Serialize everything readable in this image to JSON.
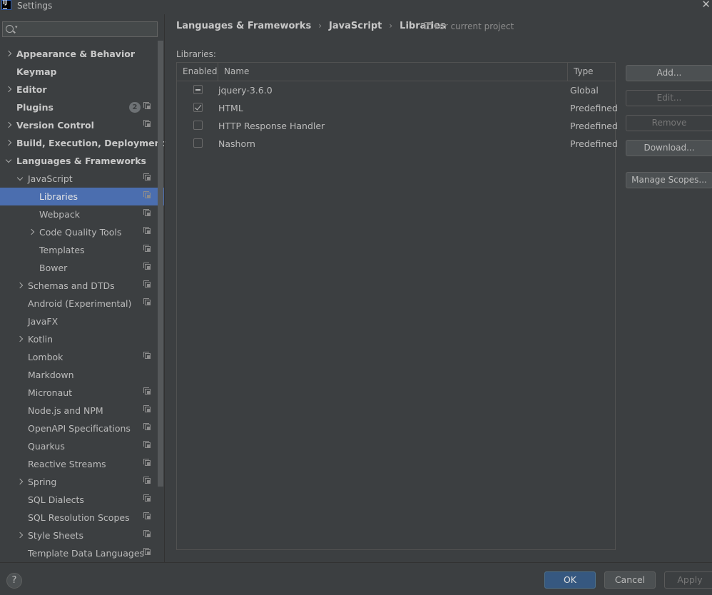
{
  "window": {
    "title": "Settings"
  },
  "search": {
    "placeholder": "",
    "value": ""
  },
  "sidebar": {
    "items": [
      {
        "label": "Appearance & Behavior"
      },
      {
        "label": "Keymap"
      },
      {
        "label": "Editor"
      },
      {
        "label": "Plugins",
        "badge": "2"
      },
      {
        "label": "Version Control"
      },
      {
        "label": "Build, Execution, Deployment"
      },
      {
        "label": "Languages & Frameworks"
      },
      {
        "label": "JavaScript"
      },
      {
        "label": "Libraries"
      },
      {
        "label": "Webpack"
      },
      {
        "label": "Code Quality Tools"
      },
      {
        "label": "Templates"
      },
      {
        "label": "Bower"
      },
      {
        "label": "Schemas and DTDs"
      },
      {
        "label": "Android (Experimental)"
      },
      {
        "label": "JavaFX"
      },
      {
        "label": "Kotlin"
      },
      {
        "label": "Lombok"
      },
      {
        "label": "Markdown"
      },
      {
        "label": "Micronaut"
      },
      {
        "label": "Node.js and NPM"
      },
      {
        "label": "OpenAPI Specifications"
      },
      {
        "label": "Quarkus"
      },
      {
        "label": "Reactive Streams"
      },
      {
        "label": "Spring"
      },
      {
        "label": "SQL Dialects"
      },
      {
        "label": "SQL Resolution Scopes"
      },
      {
        "label": "Style Sheets"
      },
      {
        "label": "Template Data Languages"
      }
    ]
  },
  "breadcrumb": [
    "Languages & Frameworks",
    "JavaScript",
    "Libraries"
  ],
  "scope_note": "For current project",
  "libraries_label": "Libraries:",
  "table": {
    "headers": {
      "enabled": "Enabled",
      "name": "Name",
      "type": "Type"
    },
    "rows": [
      {
        "name": "jquery-3.6.0",
        "type": "Global",
        "state": "indeterminate"
      },
      {
        "name": "HTML",
        "type": "Predefined",
        "state": "checked"
      },
      {
        "name": "HTTP Response Handler",
        "type": "Predefined",
        "state": "unchecked"
      },
      {
        "name": "Nashorn",
        "type": "Predefined",
        "state": "unchecked"
      }
    ]
  },
  "buttons": {
    "add": "Add...",
    "edit": "Edit...",
    "remove": "Remove",
    "download": "Download...",
    "manage_scopes": "Manage Scopes..."
  },
  "footer": {
    "help": "?",
    "ok": "OK",
    "cancel": "Cancel",
    "apply": "Apply"
  },
  "colors": {
    "background": "#3c3f41",
    "selection": "#4b6eaf",
    "ok_button": "#365880"
  }
}
